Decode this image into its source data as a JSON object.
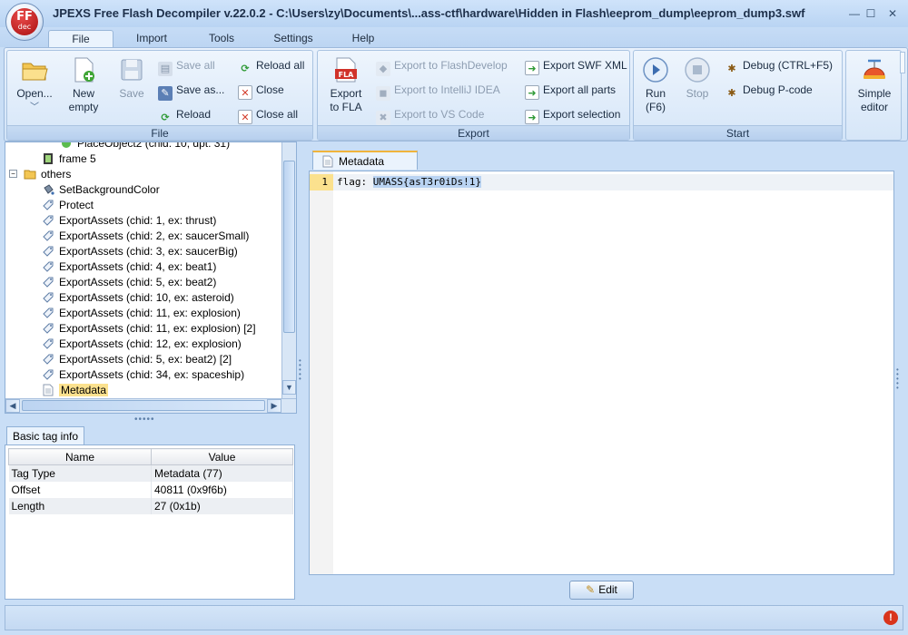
{
  "window": {
    "title": "JPEXS Free Flash Decompiler v.22.0.2 - C:\\Users\\zy\\Documents\\...ass-ctf\\hardware\\Hidden in Flash\\eeprom_dump\\eeprom_dump3.swf",
    "logo_text": "FF",
    "logo_subtext": "dec",
    "minimize": "—",
    "maximize": "☐",
    "close": "✕"
  },
  "menu_tabs": [
    "File",
    "Import",
    "Tools",
    "Settings",
    "Help"
  ],
  "active_tab": "File",
  "ribbon": {
    "file": {
      "label": "File",
      "open": "Open...",
      "new_empty_1": "New",
      "new_empty_2": "empty",
      "save": "Save",
      "save_all": "Save all",
      "save_as": "Save as...",
      "reload": "Reload",
      "reload_all": "Reload all",
      "close": "Close",
      "close_all": "Close all"
    },
    "export": {
      "label": "Export",
      "export_fla_1": "Export",
      "export_fla_2": "to FLA",
      "fla_badge": "FLA",
      "flashdevelop": "Export to FlashDevelop",
      "intellij": "Export to IntelliJ IDEA",
      "vscode": "Export to VS Code",
      "swf_xml": "Export SWF XML",
      "all_parts": "Export all parts",
      "selection": "Export selection"
    },
    "start": {
      "label": "Start",
      "run_1": "Run",
      "run_2": "(F6)",
      "stop": "Stop",
      "debug": "Debug (CTRL+F5)",
      "debug_pcode": "Debug P-code"
    },
    "view": {
      "simple_1": "Simple",
      "simple_2": "editor"
    }
  },
  "tree": {
    "items": [
      {
        "label": "PlaceObject2 (chid: 10, dpt: 31)",
        "indent": 3,
        "icon": "place-object-icon"
      },
      {
        "label": "frame 5",
        "indent": 2,
        "icon": "film-frame-icon"
      },
      {
        "label": "others",
        "indent": 0,
        "icon": "folder-icon",
        "expanded": true
      },
      {
        "label": "SetBackgroundColor",
        "indent": 2,
        "icon": "paint-bucket-icon"
      },
      {
        "label": "Protect",
        "indent": 2,
        "icon": "tag-icon"
      },
      {
        "label": "ExportAssets (chid: 1, ex: thrust)",
        "indent": 2,
        "icon": "tag-icon"
      },
      {
        "label": "ExportAssets (chid: 2, ex: saucerSmall)",
        "indent": 2,
        "icon": "tag-icon"
      },
      {
        "label": "ExportAssets (chid: 3, ex: saucerBig)",
        "indent": 2,
        "icon": "tag-icon"
      },
      {
        "label": "ExportAssets (chid: 4, ex: beat1)",
        "indent": 2,
        "icon": "tag-icon"
      },
      {
        "label": "ExportAssets (chid: 5, ex: beat2)",
        "indent": 2,
        "icon": "tag-icon"
      },
      {
        "label": "ExportAssets (chid: 10, ex: asteroid)",
        "indent": 2,
        "icon": "tag-icon"
      },
      {
        "label": "ExportAssets (chid: 11, ex: explosion)",
        "indent": 2,
        "icon": "tag-icon"
      },
      {
        "label": "ExportAssets (chid: 11, ex: explosion) [2]",
        "indent": 2,
        "icon": "tag-icon"
      },
      {
        "label": "ExportAssets (chid: 12, ex: explosion)",
        "indent": 2,
        "icon": "tag-icon"
      },
      {
        "label": "ExportAssets (chid: 5, ex: beat2) [2]",
        "indent": 2,
        "icon": "tag-icon"
      },
      {
        "label": "ExportAssets (chid: 34, ex: spaceship)",
        "indent": 2,
        "icon": "tag-icon"
      },
      {
        "label": "Metadata",
        "indent": 2,
        "icon": "document-icon",
        "selected": true
      }
    ]
  },
  "basic_tag_info": {
    "tab_label": "Basic tag info",
    "headers": [
      "Name",
      "Value"
    ],
    "rows": [
      [
        "Tag Type",
        "Metadata (77)"
      ],
      [
        "Offset",
        "40811 (0x9f6b)"
      ],
      [
        "Length",
        "27 (0x1b)"
      ]
    ]
  },
  "editor": {
    "tab_label": "Metadata",
    "line_number": "1",
    "code_prefix": "flag: ",
    "code_selected": "UMASS{asT3r0iDs!1}"
  },
  "edit_button": "Edit",
  "colors": {
    "selection_highlight": "#fbe18e",
    "accent": "#f0b43c",
    "error_badge": "#d9341c"
  }
}
